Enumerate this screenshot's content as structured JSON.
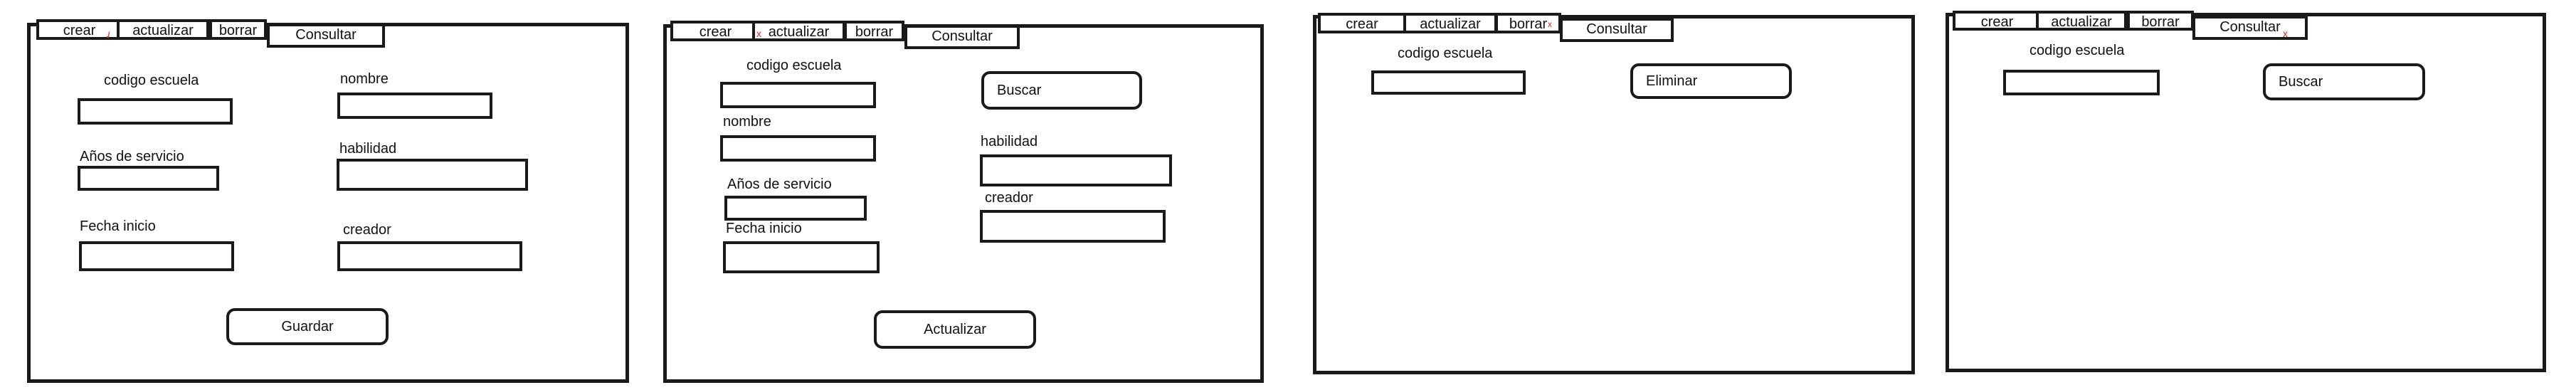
{
  "tabs": {
    "crear": "crear",
    "actualizar": "actualizar",
    "borrar": "borrar",
    "consultar": "Consultar"
  },
  "fields": {
    "codigo_escuela": "codigo escuela",
    "nombre": "nombre",
    "anios_servicio": "Años de servicio",
    "habilidad": "habilidad",
    "fecha_inicio": "Fecha inicio",
    "creador": "creador"
  },
  "buttons": {
    "guardar": "Guardar",
    "buscar": "Buscar",
    "actualizar": "Actualizar",
    "eliminar": "Eliminar"
  },
  "marks": {
    "check": "✓",
    "x": "x"
  }
}
